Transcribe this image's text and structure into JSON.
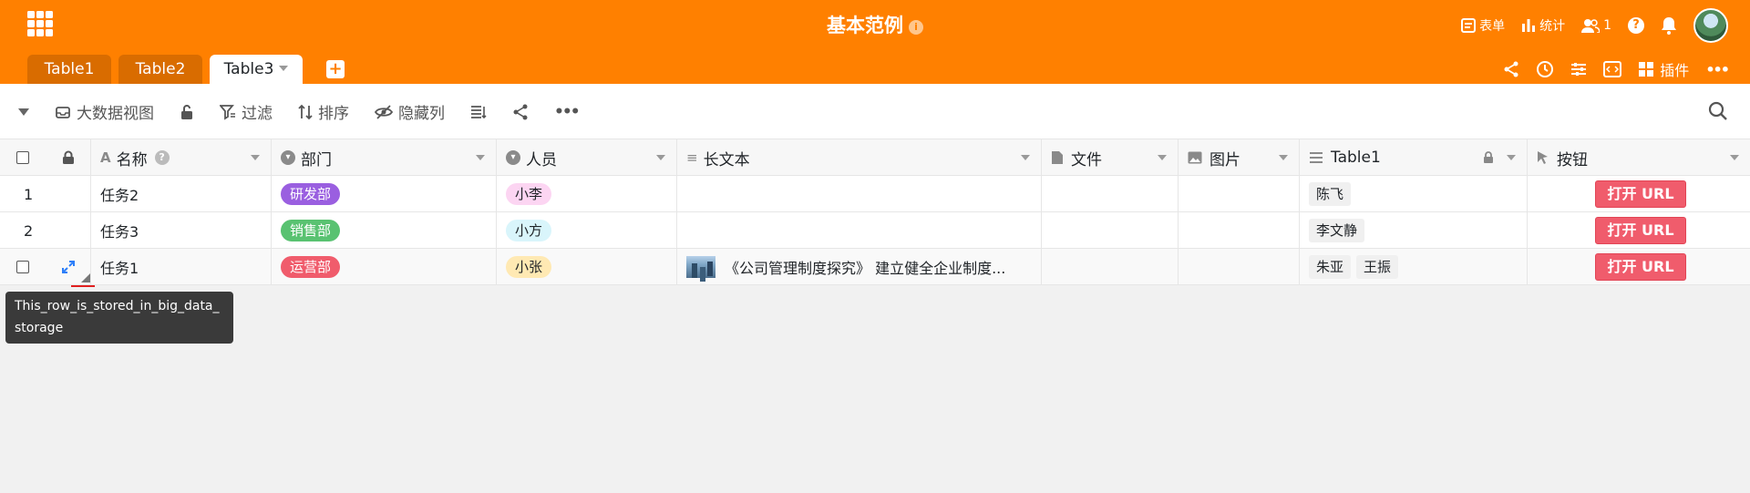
{
  "header": {
    "title": "基本范例",
    "info_icon": "i",
    "right": {
      "form_label": "表单",
      "stats_label": "统计",
      "collaborators_count": "1",
      "help_icon": "?"
    }
  },
  "tabs": [
    {
      "label": "Table1"
    },
    {
      "label": "Table2"
    },
    {
      "label": "Table3"
    }
  ],
  "tab_add": "+",
  "tabbar_right": {
    "plugin_label": "插件",
    "more": "•••"
  },
  "view_toolbar": {
    "view_name": "大数据视图",
    "filter_label": "过滤",
    "sort_label": "排序",
    "hide_label": "隐藏列",
    "more": "•••"
  },
  "columns": [
    {
      "label": "名称",
      "icon": "A"
    },
    {
      "label": "部门",
      "icon": "▾"
    },
    {
      "label": "人员",
      "icon": "▾"
    },
    {
      "label": "长文本",
      "icon": "≡"
    },
    {
      "label": "文件",
      "icon": "file-icon"
    },
    {
      "label": "图片",
      "icon": "image-icon"
    },
    {
      "label": "Table1",
      "icon": "link-icon"
    },
    {
      "label": "按钮",
      "icon": "cursor-icon"
    }
  ],
  "rows": [
    {
      "index": "1",
      "name": "任务2",
      "dept": "研发部",
      "dept_color": "#9a5fe0",
      "person": "小李",
      "person_color": "#fcd5f2",
      "long_text": "",
      "links": [
        "陈飞"
      ],
      "button": "打开 URL"
    },
    {
      "index": "2",
      "name": "任务3",
      "dept": "销售部",
      "dept_color": "#59c271",
      "person": "小方",
      "person_color": "#d9f5fb",
      "long_text": "",
      "links": [
        "李文静"
      ],
      "button": "打开 URL"
    },
    {
      "index": "",
      "name": "任务1",
      "dept": "运营部",
      "dept_color": "#f05c6c",
      "person": "小张",
      "person_color": "#ffe9b3",
      "long_text": "《公司管理制度探究》 建立健全企业制度...",
      "links": [
        "朱亚",
        "王振"
      ],
      "button": "打开 URL"
    }
  ],
  "tooltip": "This_row_is_stored_in_big_data_storage",
  "colors": {
    "brand": "#ff8000",
    "tab_inactive": "#d96c00",
    "button": "#f05c6c"
  }
}
